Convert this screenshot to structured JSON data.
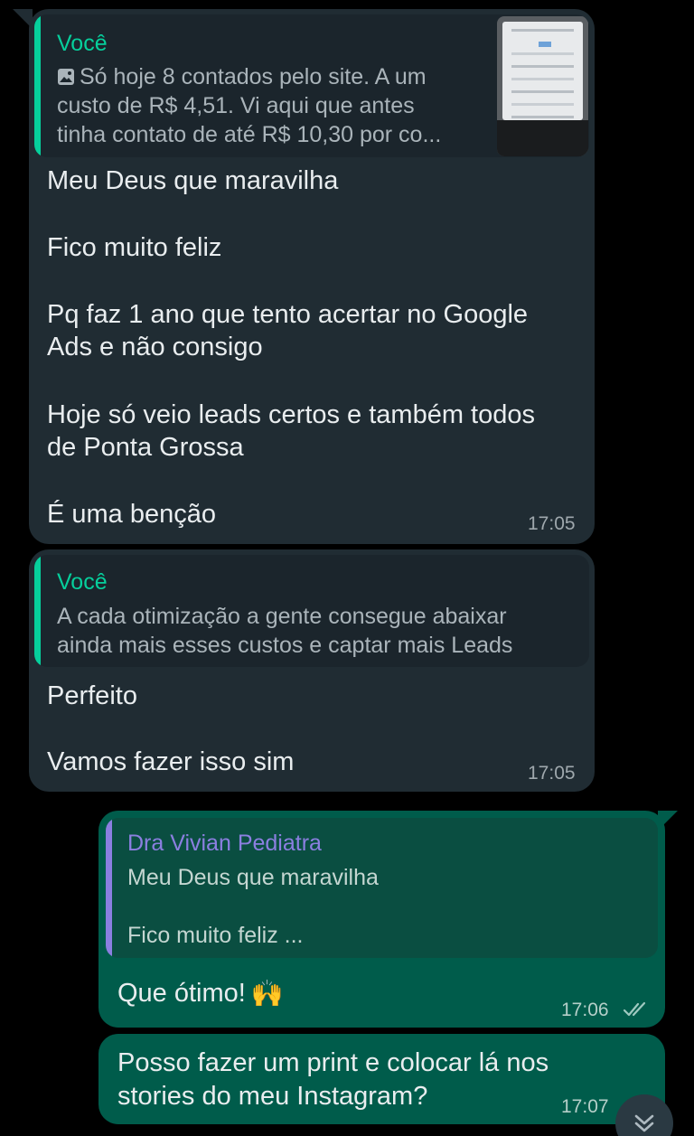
{
  "messages": [
    {
      "direction": "incoming",
      "quote": {
        "author": "Você",
        "text_line1": "Só hoje 8 contados pelo site. A um",
        "text_line2": "custo de R$ 4,51. Vi aqui que antes",
        "text_line3": "tinha contato de até R$ 10,30 por co...",
        "attachment_icon": "photo-icon"
      },
      "lines": [
        "Meu Deus que maravilha",
        "Fico muito feliz",
        "Pq faz 1 ano que tento acertar no Google",
        "Ads e não consigo",
        "Hoje só veio leads certos e também todos",
        "de Ponta Grossa",
        "É uma benção"
      ],
      "time": "17:05"
    },
    {
      "direction": "incoming",
      "quote": {
        "author": "Você",
        "text_line1": "A cada otimização a gente consegue abaixar",
        "text_line2": "ainda mais esses custos e captar mais Leads"
      },
      "lines": [
        "Perfeito",
        "Vamos fazer isso sim"
      ],
      "time": "17:05"
    },
    {
      "direction": "outgoing",
      "quote": {
        "author": "Dra Vivian Pediatra",
        "text_line1": "Meu Deus que maravilha",
        "text_line2": "Fico muito feliz ..."
      },
      "lines": [
        "Que ótimo!"
      ],
      "emoji": "🙌",
      "time": "17:06",
      "status": "read"
    },
    {
      "direction": "outgoing",
      "lines": [
        "Posso fazer um print e colocar lá nos",
        "stories do meu Instagram?"
      ],
      "time": "17:07"
    }
  ],
  "colors": {
    "background": "#000000",
    "incoming_bubble": "#202c33",
    "outgoing_bubble": "#005c4b",
    "quote_you_accent": "#06cf9c",
    "quote_contact_accent": "#8b7fe0",
    "read_ticks": "#9fc9c0"
  },
  "icons": {
    "scroll_down": "chevron-double-down-icon",
    "read_status": "double-check-icon"
  }
}
